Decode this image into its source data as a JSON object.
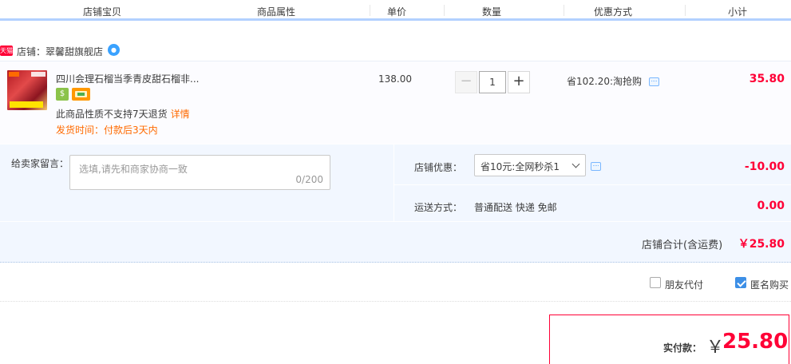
{
  "header": {
    "columns": [
      "店铺宝贝",
      "商品属性",
      "单价",
      "数量",
      "优惠方式",
      "小计"
    ]
  },
  "shop": {
    "tag": "天猫",
    "name": "店铺：翠馨甜旗舰店"
  },
  "item": {
    "title": "四川会理石榴当季青皮甜石榴非...",
    "return_note": "此商品性质不支持7天退货",
    "return_link": "详情",
    "ship_time": "发货时间：付款后3天内",
    "unit_price": "138.00",
    "quantity": "1",
    "discount": "省102.20:淘抢购",
    "subtotal": "35.80"
  },
  "options": {
    "memo_label": "给卖家留言：",
    "memo_placeholder": "选填,请先和商家协商一致",
    "memo_count": "0/200",
    "coupon_label": "店铺优惠：",
    "coupon_selected": "省10元:全网秒杀1",
    "coupon_amount": "-10.00",
    "shipping_label": "运送方式：",
    "shipping_method": "普通配送 快递 免邮",
    "shipping_fee": "0.00",
    "shop_total_label": "店铺合计(含运费)",
    "shop_total": "￥25.80"
  },
  "checkout": {
    "friend_pay_label": "朋友代付",
    "friend_pay_checked": false,
    "anonymous_label": "匿名购买",
    "anonymous_checked": true,
    "pay_label": "实付款：",
    "currency": "￥",
    "pay_amount": "25.80"
  },
  "colors": {
    "accent_red": "#ff0036",
    "accent_orange": "#ff6a00",
    "header_underline": "#b2d1ff",
    "options_bg": "#f2f7ff"
  }
}
